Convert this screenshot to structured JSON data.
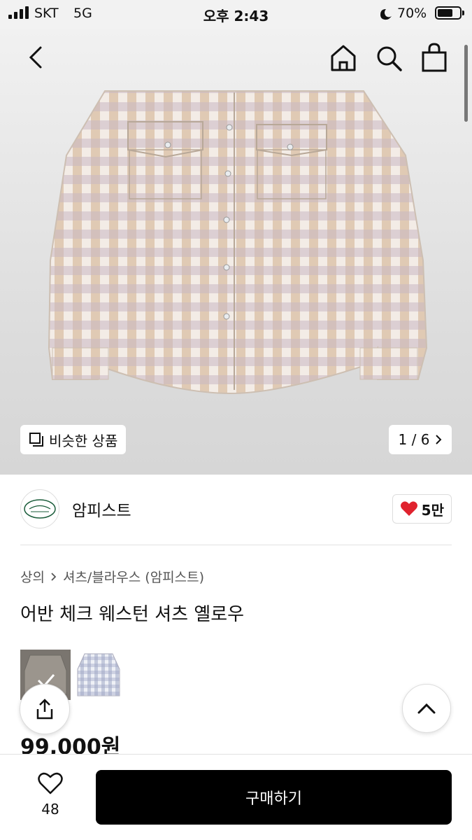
{
  "status": {
    "carrier": "SKT",
    "network": "5G",
    "time": "오후 2:43",
    "battery": "70%"
  },
  "gallery": {
    "similar_label": "비슷한 상품",
    "counter": "1 / 6"
  },
  "seller": {
    "name": "암피스트",
    "likes": "5만"
  },
  "breadcrumb": {
    "first": "상의",
    "second": "셔츠/블라우스 (암피스트)"
  },
  "product": {
    "title": "어반 체크 웨스턴 셔츠 옐로우",
    "price": "99,000원"
  },
  "bottom": {
    "wish_count": "48",
    "buy_label": "구매하기"
  },
  "colors": {
    "accent_heart": "#e0222e",
    "buy_button": "#000000"
  },
  "icons": [
    "back-icon",
    "home-icon",
    "search-icon",
    "bag-icon",
    "stack-icon",
    "chevron-right-icon",
    "heart-icon",
    "share-icon",
    "arrow-up-icon",
    "heart-outline-icon"
  ]
}
